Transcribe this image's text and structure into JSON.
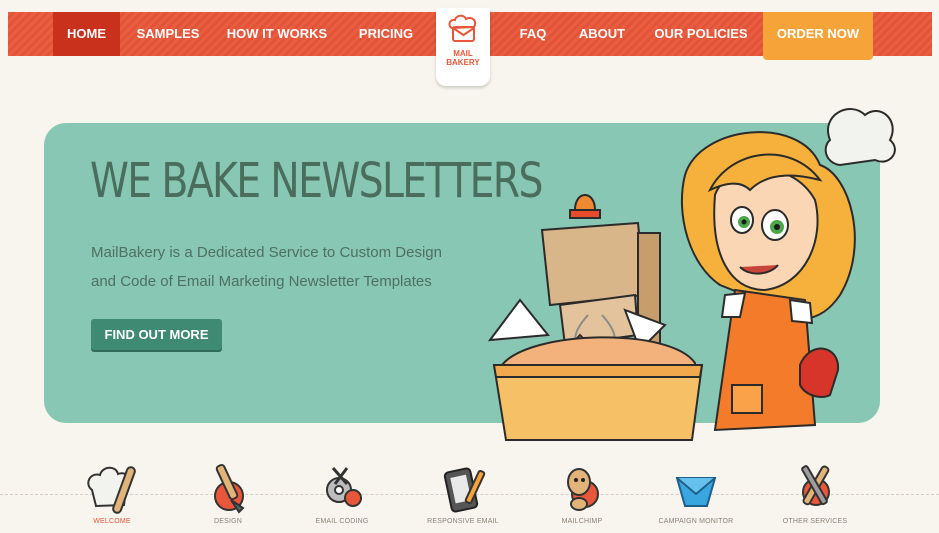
{
  "nav": {
    "items": [
      {
        "label": "HOME",
        "active": true
      },
      {
        "label": "SAMPLES"
      },
      {
        "label": "HOW IT WORKS"
      },
      {
        "label": "PRICING"
      },
      {
        "label": "FAQ"
      },
      {
        "label": "ABOUT"
      },
      {
        "label": "OUR POLICIES"
      }
    ],
    "order_label": "ORDER NOW",
    "logo_lines": [
      "MAIL",
      "BAKERY"
    ]
  },
  "hero": {
    "title": "WE BAKE NEWSLETTERS",
    "line1": "MailBakery is a Dedicated Service to Custom Design",
    "line2": "and Code of Email Marketing Newsletter Templates",
    "cta": "FIND OUT MORE"
  },
  "features": [
    {
      "label": "WELCOME",
      "icon": "chef-hat-rolling-pin-icon",
      "active": true
    },
    {
      "label": "DESIGN",
      "icon": "paintbrush-icon"
    },
    {
      "label": "EMAIL CODING",
      "icon": "gears-scissors-icon"
    },
    {
      "label": "RESPONSIVE EMAIL",
      "icon": "phone-pencil-icon"
    },
    {
      "label": "MAILCHIMP",
      "icon": "mailchimp-icon"
    },
    {
      "label": "CAMPAIGN MONITOR",
      "icon": "campaign-monitor-icon"
    },
    {
      "label": "OTHER SERVICES",
      "icon": "tools-icon"
    }
  ],
  "colors": {
    "nav": "#e8573a",
    "nav_active": "#c9311c",
    "order": "#f6a43a",
    "hero_bg": "#88c7b3",
    "hero_text": "#4a6d5e",
    "cta": "#3f8a73",
    "page_bg": "#f8f5ee"
  }
}
